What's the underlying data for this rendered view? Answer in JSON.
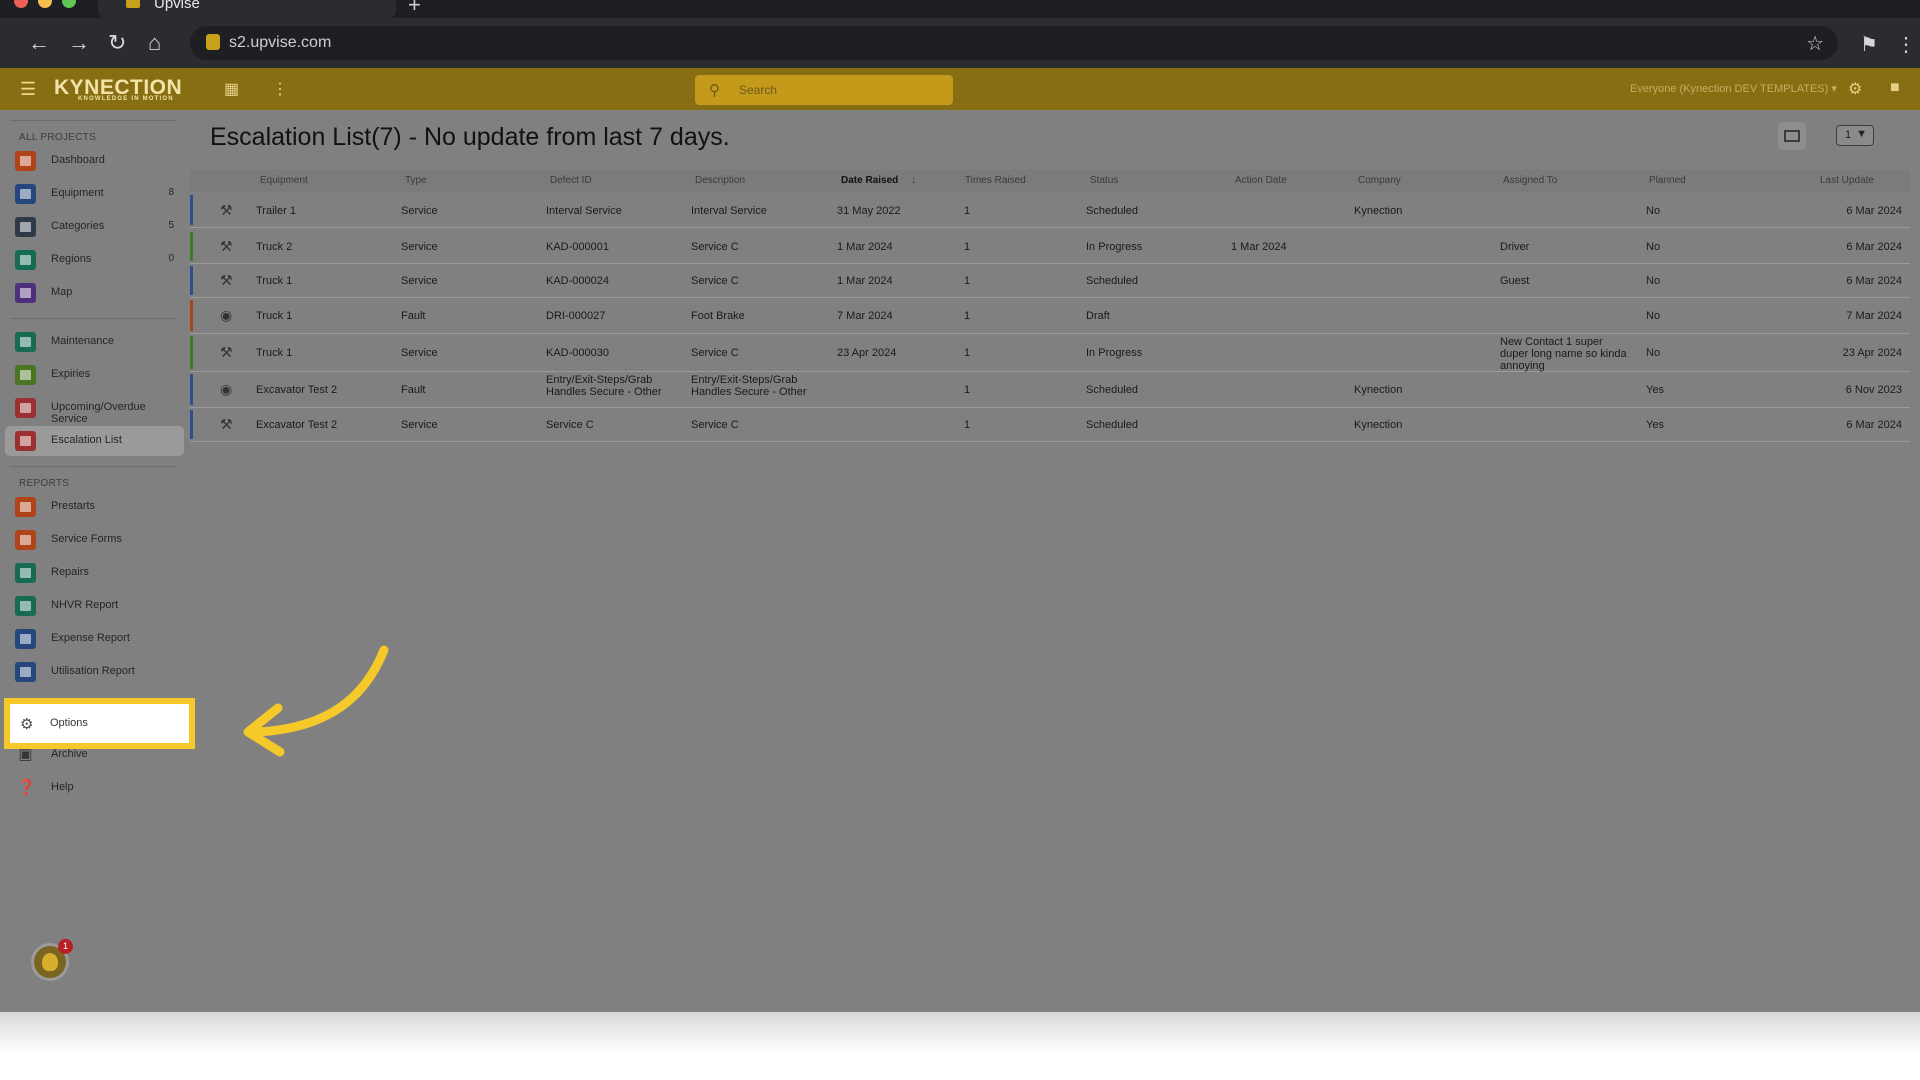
{
  "browser": {
    "tab_title": "Upvise",
    "url": "s2.upvise.com",
    "new_tab": "+"
  },
  "app": {
    "logo": "KYNECTION",
    "logo_tagline": "KNOWLEDGE IN MOTION",
    "search_placeholder": "Search",
    "group_selector": "Everyone (Kynection DEV TEMPLATES) ▾"
  },
  "sidebar": {
    "section_projects": "ALL PROJECTS",
    "section_reports": "REPORTS",
    "items": [
      {
        "label": "Dashboard",
        "icon": "dashboard-icon",
        "color": "#b04318",
        "count": ""
      },
      {
        "label": "Equipment",
        "icon": "wrench-icon",
        "color": "#26477e",
        "count": "8"
      },
      {
        "label": "Categories",
        "icon": "folder-icon",
        "color": "#2f3a48",
        "count": "5"
      },
      {
        "label": "Regions",
        "icon": "location-pin-icon",
        "color": "#166b52",
        "count": "0"
      },
      {
        "label": "Map",
        "icon": "map-icon",
        "color": "#4e2f7b",
        "count": ""
      },
      {
        "label": "Maintenance",
        "icon": "calendar-icon",
        "color": "#166b52",
        "count": ""
      },
      {
        "label": "Expiries",
        "icon": "calendar-check-icon",
        "color": "#4a7523",
        "count": ""
      },
      {
        "label": "Upcoming/Overdue Service",
        "icon": "service-due-icon",
        "color": "#9c2f2f",
        "count": ""
      },
      {
        "label": "Escalation List",
        "icon": "escalation-icon",
        "color": "#9c2f2f",
        "count": ""
      },
      {
        "label": "Prestarts",
        "icon": "checklist-icon",
        "color": "#b04318",
        "count": ""
      },
      {
        "label": "Service Forms",
        "icon": "wrench-icon",
        "color": "#b04318",
        "count": ""
      },
      {
        "label": "Repairs",
        "icon": "bar-chart-icon",
        "color": "#166b52",
        "count": ""
      },
      {
        "label": "NHVR Report",
        "icon": "bar-chart-icon",
        "color": "#166b52",
        "count": ""
      },
      {
        "label": "Expense Report",
        "icon": "bar-chart-icon",
        "color": "#26477e",
        "count": ""
      },
      {
        "label": "Utilisation Report",
        "icon": "clock-icon",
        "color": "#26477e",
        "count": ""
      }
    ],
    "options": "Options",
    "archive": "Archive",
    "help": "Help",
    "notification_count": "1"
  },
  "page": {
    "title": "Escalation List(7) - No update from last 7 days.",
    "page_select": "1"
  },
  "table": {
    "columns": [
      "Equipment",
      "Type",
      "Defect ID",
      "Description",
      "Date Raised",
      "Times Raised",
      "Status",
      "Action Date",
      "Company",
      "Assigned To",
      "Planned",
      "Last Update"
    ],
    "sort_marker": "↓",
    "rows": [
      {
        "icon": "wrench-icon",
        "bar": "#2f4f8f",
        "equipment": "Trailer 1",
        "type": "Service",
        "defect_id": "Interval Service",
        "description": "Interval Service",
        "date_raised": "31 May 2022",
        "times_raised": "1",
        "status": "Scheduled",
        "action_date": "",
        "company": "Kynection",
        "assigned_to": "",
        "planned": "No",
        "last_update": "6 Mar 2024"
      },
      {
        "icon": "wrench-icon",
        "bar": "#3f7a2a",
        "equipment": "Truck 2",
        "type": "Service",
        "defect_id": "KAD-000001",
        "description": "Service C",
        "date_raised": "1 Mar 2024",
        "times_raised": "1",
        "status": "In Progress",
        "action_date": "1 Mar 2024",
        "company": "",
        "assigned_to": "Driver",
        "planned": "No",
        "last_update": "6 Mar 2024"
      },
      {
        "icon": "wrench-icon",
        "bar": "#2f4f8f",
        "equipment": "Truck 1",
        "type": "Service",
        "defect_id": "KAD-000024",
        "description": "Service C",
        "date_raised": "1 Mar 2024",
        "times_raised": "1",
        "status": "Scheduled",
        "action_date": "",
        "company": "",
        "assigned_to": "Guest",
        "planned": "No",
        "last_update": "6 Mar 2024"
      },
      {
        "icon": "eye-icon",
        "bar": "#a3471a",
        "equipment": "Truck 1",
        "type": "Fault",
        "defect_id": "DRI-000027",
        "description": "Foot Brake",
        "date_raised": "7 Mar 2024",
        "times_raised": "1",
        "status": "Draft",
        "action_date": "",
        "company": "",
        "assigned_to": "",
        "planned": "No",
        "last_update": "7 Mar 2024"
      },
      {
        "icon": "wrench-icon",
        "bar": "#3f7a2a",
        "equipment": "Truck 1",
        "type": "Service",
        "defect_id": "KAD-000030",
        "description": "Service C",
        "date_raised": "23 Apr 2024",
        "times_raised": "1",
        "status": "In Progress",
        "action_date": "",
        "company": "",
        "assigned_to": "New Contact 1 super duper long name so kinda annoying",
        "planned": "No",
        "last_update": "23 Apr 2024"
      },
      {
        "icon": "eye-icon",
        "bar": "#2f4f8f",
        "equipment": "Excavator Test 2",
        "type": "Fault",
        "defect_id": "Entry/Exit-Steps/Grab Handles Secure - Other",
        "description": "Entry/Exit-Steps/Grab Handles Secure - Other",
        "date_raised": "",
        "times_raised": "1",
        "status": "Scheduled",
        "action_date": "",
        "company": "Kynection",
        "assigned_to": "",
        "planned": "Yes",
        "last_update": "6 Nov 2023"
      },
      {
        "icon": "wrench-icon",
        "bar": "#2f4f8f",
        "equipment": "Excavator Test 2",
        "type": "Service",
        "defect_id": "Service C",
        "description": "Service C",
        "date_raised": "",
        "times_raised": "1",
        "status": "Scheduled",
        "action_date": "",
        "company": "Kynection",
        "assigned_to": "",
        "planned": "Yes",
        "last_update": "6 Mar 2024"
      }
    ]
  }
}
